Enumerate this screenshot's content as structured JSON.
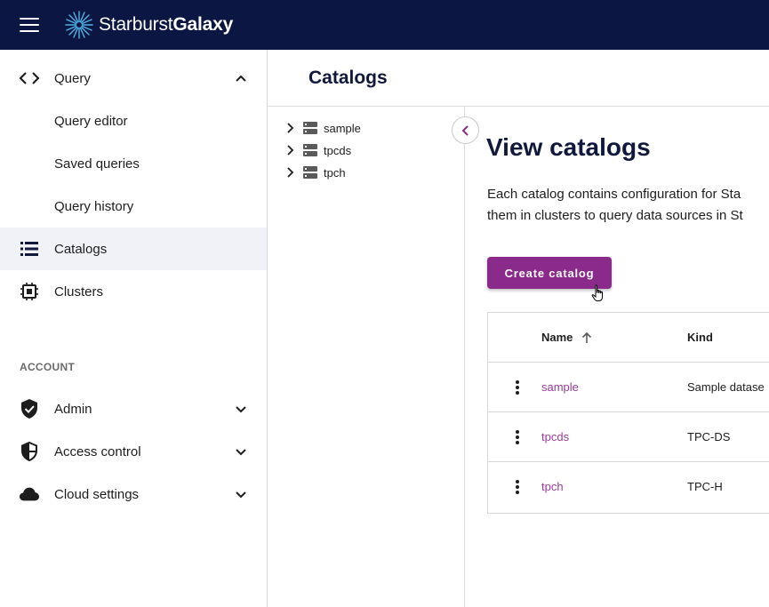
{
  "brand": {
    "name_light": "Starburst",
    "name_bold": "Galaxy"
  },
  "colors": {
    "topbar": "#0c1642",
    "accent": "#8a2a8b",
    "link": "#9b3b9c",
    "active_nav": "#f1f2f8"
  },
  "sidebar": {
    "query": {
      "label": "Query",
      "icon": "code-icon",
      "expanded": true
    },
    "query_children": [
      {
        "label": "Query editor"
      },
      {
        "label": "Saved queries"
      },
      {
        "label": "Query history"
      }
    ],
    "catalogs": {
      "label": "Catalogs",
      "icon": "list-icon",
      "active": true
    },
    "clusters": {
      "label": "Clusters",
      "icon": "chip-icon"
    },
    "account_title": "ACCOUNT",
    "admin": {
      "label": "Admin",
      "icon": "shield-check-icon"
    },
    "access_control": {
      "label": "Access control",
      "icon": "shield-half-icon"
    },
    "cloud_settings": {
      "label": "Cloud settings",
      "icon": "cloud-icon"
    }
  },
  "header": {
    "title": "Catalogs"
  },
  "tree": {
    "items": [
      {
        "label": "sample"
      },
      {
        "label": "tpcds"
      },
      {
        "label": "tpch"
      }
    ]
  },
  "main": {
    "heading": "View catalogs",
    "description_line1": "Each catalog contains configuration for Sta",
    "description_line2": "them in clusters to query data sources in St",
    "create_button": "Create catalog"
  },
  "table": {
    "columns": {
      "name": "Name",
      "kind": "Kind",
      "sort": "ascending"
    },
    "rows": [
      {
        "name": "sample",
        "kind": "Sample datase"
      },
      {
        "name": "tpcds",
        "kind": "TPC-DS"
      },
      {
        "name": "tpch",
        "kind": "TPC-H"
      }
    ]
  }
}
